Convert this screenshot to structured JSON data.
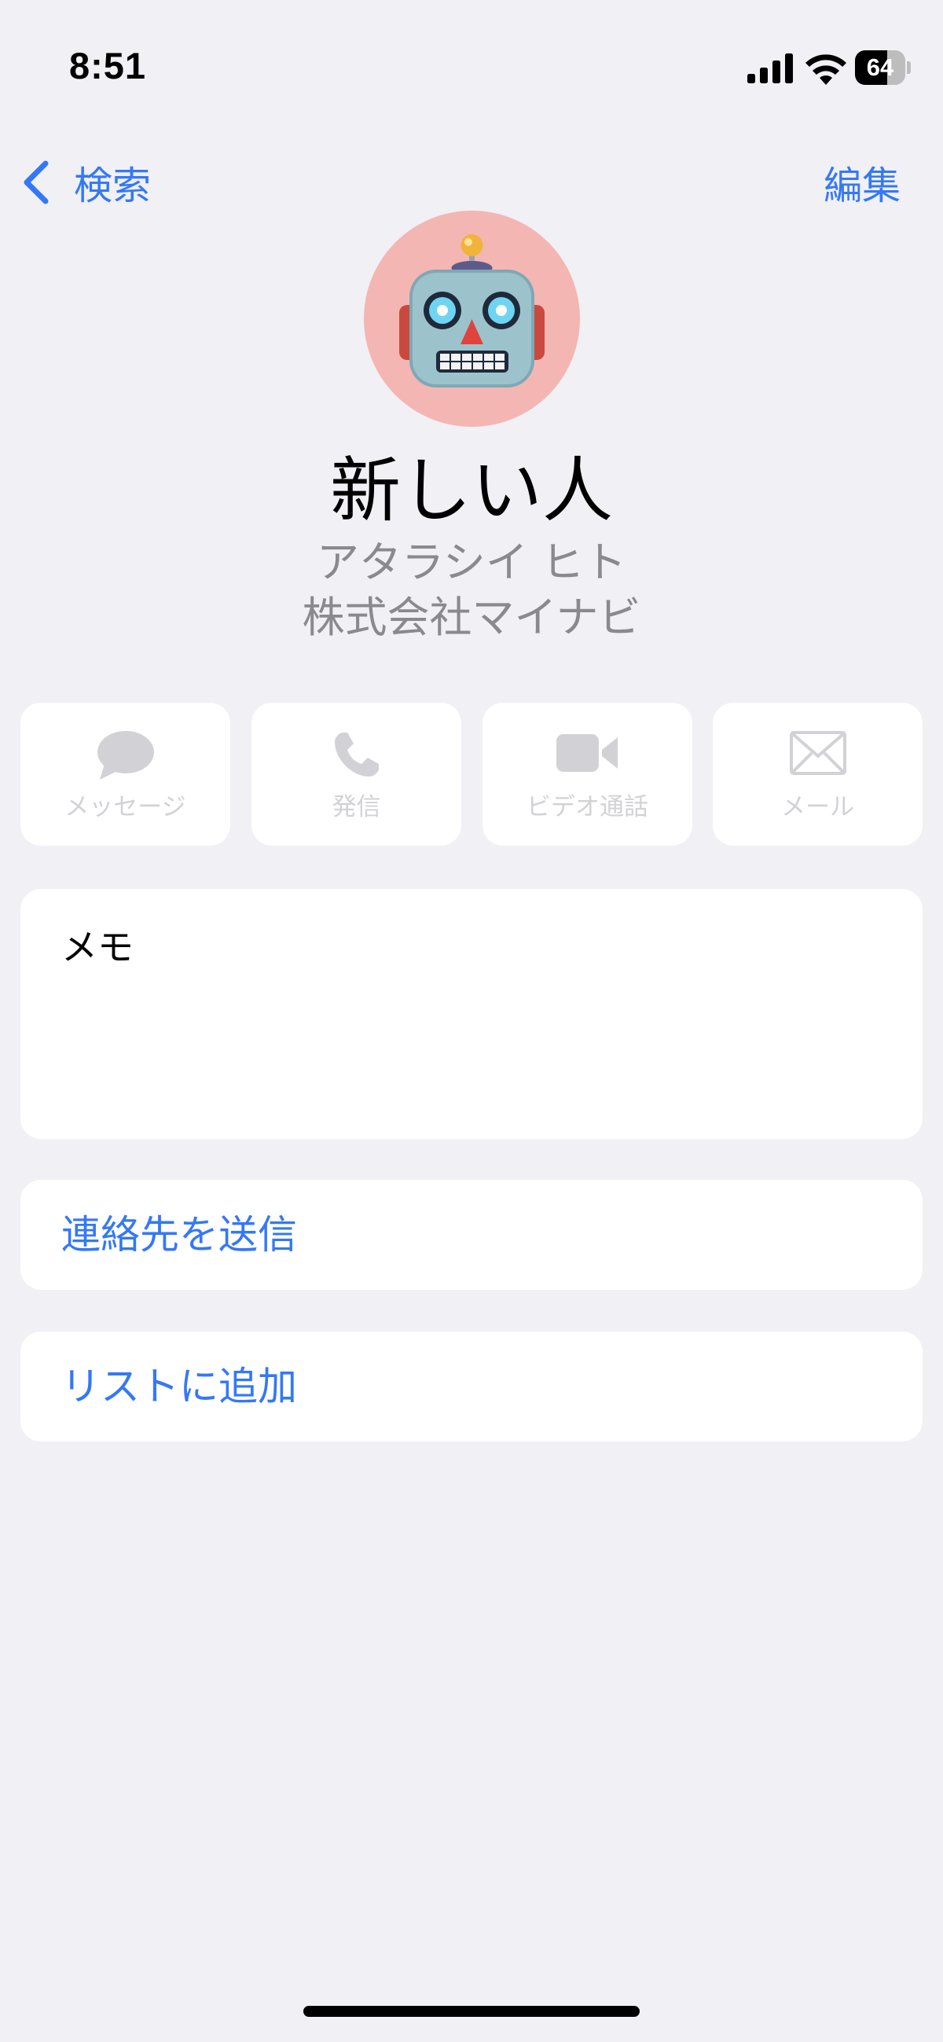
{
  "status_bar": {
    "time": "8:51",
    "battery_level": "64",
    "battery_fraction": 0.64,
    "icons": [
      "cellular-signal-icon",
      "wifi-icon",
      "battery-icon"
    ]
  },
  "nav": {
    "back_label": "検索",
    "edit_label": "編集"
  },
  "contact": {
    "avatar_icon": "robot-emoji",
    "avatar_background": "#f4b6b3",
    "name": "新しい人",
    "phonetic": "アタラシイ ヒト",
    "company": "株式会社マイナビ"
  },
  "actions": [
    {
      "label": "メッセージ",
      "icon": "message-bubble-icon",
      "enabled": false
    },
    {
      "label": "発信",
      "icon": "phone-icon",
      "enabled": false
    },
    {
      "label": "ビデオ通話",
      "icon": "video-camera-icon",
      "enabled": false
    },
    {
      "label": "メール",
      "icon": "mail-envelope-icon",
      "enabled": false
    }
  ],
  "memo": {
    "label": "メモ",
    "value": ""
  },
  "rows": {
    "send_contact": "連絡先を送信",
    "add_to_list": "リストに追加"
  },
  "colors": {
    "accent": "#3478f6",
    "background": "#f0f0f5",
    "disabled": "#d2d2d6",
    "secondary_text": "#8a8a8e"
  }
}
